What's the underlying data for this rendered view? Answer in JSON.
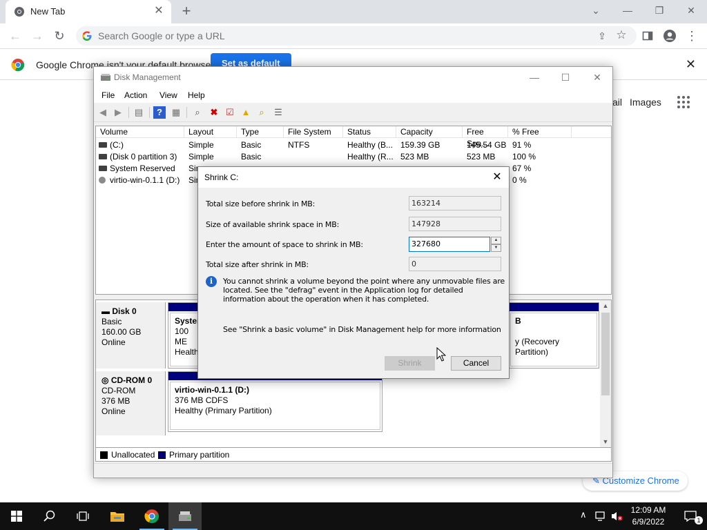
{
  "chrome": {
    "tab_title": "New Tab",
    "omnibox_placeholder": "Search Google or type a URL",
    "infobar_message": "Google Chrome isn't your default browser",
    "infobar_button": "Set as default",
    "ntp_gmail": "ail",
    "ntp_images": "Images",
    "customize": "Customize Chrome"
  },
  "disk_management": {
    "title": "Disk Management",
    "menu": [
      "File",
      "Action",
      "View",
      "Help"
    ],
    "columns": [
      "Volume",
      "Layout",
      "Type",
      "File System",
      "Status",
      "Capacity",
      "Free Spa...",
      "% Free"
    ],
    "volumes": [
      {
        "volume": "(C:)",
        "layout": "Simple",
        "type": "Basic",
        "fs": "NTFS",
        "status": "Healthy (B...",
        "capacity": "159.39 GB",
        "free": "145.54 GB",
        "pct": "91 %"
      },
      {
        "volume": "(Disk 0 partition 3)",
        "layout": "Simple",
        "type": "Basic",
        "fs": "",
        "status": "Healthy (R...",
        "capacity": "523 MB",
        "free": "523 MB",
        "pct": "100 %"
      },
      {
        "volume": "System Reserved",
        "layout": "Sim",
        "type": "",
        "fs": "",
        "status": "",
        "capacity": "",
        "free": "",
        "pct": "67 %"
      },
      {
        "volume": "virtio-win-0.1.1 (D:)",
        "layout": "Sin",
        "type": "",
        "fs": "",
        "status": "",
        "capacity": "",
        "free": "",
        "pct": "0 %"
      }
    ],
    "disk0": {
      "name": "Disk 0",
      "type": "Basic",
      "size": "160.00 GB",
      "state": "Online",
      "part1": {
        "name": "System",
        "size": "100 ME",
        "status": "Healthy"
      },
      "part3": {
        "name": "B",
        "status": "y (Recovery Partition)"
      }
    },
    "cdrom0": {
      "name": "CD-ROM 0",
      "type": "CD-ROM",
      "size": "376 MB",
      "state": "Online",
      "part": {
        "name": "virtio-win-0.1.1  (D:)",
        "size": "376 MB CDFS",
        "status": "Healthy (Primary Partition)"
      }
    },
    "legend": {
      "unallocated": "Unallocated",
      "primary": "Primary partition"
    }
  },
  "shrink_dialog": {
    "title": "Shrink C:",
    "total_before_label": "Total size before shrink in MB:",
    "total_before_value": "163214",
    "available_label": "Size of available shrink space in MB:",
    "available_value": "147928",
    "amount_label": "Enter the amount of space to shrink in MB:",
    "amount_value": "327680",
    "total_after_label": "Total size after shrink in MB:",
    "total_after_value": "0",
    "info_text": "You cannot shrink a volume beyond the point where any unmovable files are located. See the \"defrag\" event in the Application log for detailed information about the operation when it has completed.",
    "help_text": "See \"Shrink a basic volume\" in Disk Management help for more information",
    "shrink_button": "Shrink",
    "cancel_button": "Cancel"
  },
  "taskbar": {
    "time": "12:09 AM",
    "date": "6/9/2022",
    "notification_count": "1"
  },
  "colors": {
    "primary_partition": "#00007f",
    "chrome_blue": "#1a73e8",
    "taskbar": "#101010"
  }
}
